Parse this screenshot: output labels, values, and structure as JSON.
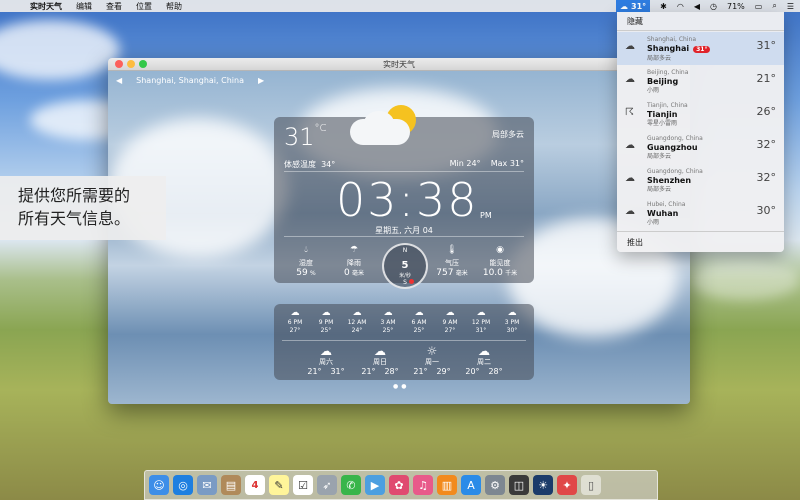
{
  "menubar": {
    "app_name": "实时天气",
    "items": [
      "编辑",
      "查看",
      "位置",
      "帮助"
    ],
    "weather_temp": "31°",
    "battery": "71%"
  },
  "window": {
    "title": "实时天气",
    "location": "Shanghai, Shanghai, China",
    "temp": "31",
    "temp_unit": "°C",
    "condition": "局部多云",
    "feels_like_label": "体感温度",
    "feels_like": "34°",
    "min_label": "Min",
    "min": "24°",
    "max_label": "Max",
    "max": "31°",
    "clock": "03:38",
    "ampm": "PM",
    "date": "星期五, 六月 04",
    "stats": {
      "humidity_label": "湿度",
      "humidity": "59",
      "humidity_unit": "%",
      "rain_label": "降雨",
      "rain": "0",
      "rain_unit": "毫米",
      "wind_speed": "5",
      "wind_unit": "米/秒",
      "pressure_label": "气压",
      "pressure": "757",
      "pressure_unit": "毫米",
      "visibility_label": "能见度",
      "visibility": "10.0",
      "visibility_unit": "千米"
    },
    "hourly": [
      {
        "time": "6 PM",
        "temp": "27°"
      },
      {
        "time": "9 PM",
        "temp": "25°"
      },
      {
        "time": "12 AM",
        "temp": "24°"
      },
      {
        "time": "3 AM",
        "temp": "25°"
      },
      {
        "time": "6 AM",
        "temp": "25°"
      },
      {
        "time": "9 AM",
        "temp": "27°"
      },
      {
        "time": "12 PM",
        "temp": "31°"
      },
      {
        "time": "3 PM",
        "temp": "30°"
      }
    ],
    "daily": [
      {
        "day": "周六",
        "low": "21°",
        "high": "31°"
      },
      {
        "day": "周日",
        "low": "21°",
        "high": "28°"
      },
      {
        "day": "周一",
        "low": "21°",
        "high": "29°"
      },
      {
        "day": "周二",
        "low": "20°",
        "high": "28°"
      }
    ]
  },
  "caption": {
    "line1": "提供您所需要的",
    "line2": "所有天气信息。"
  },
  "dropdown": {
    "hide": "隐藏",
    "quit": "推出",
    "badge": "31°",
    "cities": [
      {
        "region": "Shanghai, China",
        "name": "Shanghai",
        "cond": "局部多云",
        "temp": "31°"
      },
      {
        "region": "Beijing, China",
        "name": "Beijing",
        "cond": "小雨",
        "temp": "21°"
      },
      {
        "region": "Tianjin, China",
        "name": "Tianjin",
        "cond": "零星小雷雨",
        "temp": "26°"
      },
      {
        "region": "Guangdong, China",
        "name": "Guangzhou",
        "cond": "局部多云",
        "temp": "32°"
      },
      {
        "region": "Guangdong, China",
        "name": "Shenzhen",
        "cond": "局部多云",
        "temp": "32°"
      },
      {
        "region": "Hubei, China",
        "name": "Wuhan",
        "cond": "小雨",
        "temp": "30°"
      }
    ]
  },
  "dock": {
    "calendar_day": "4"
  }
}
